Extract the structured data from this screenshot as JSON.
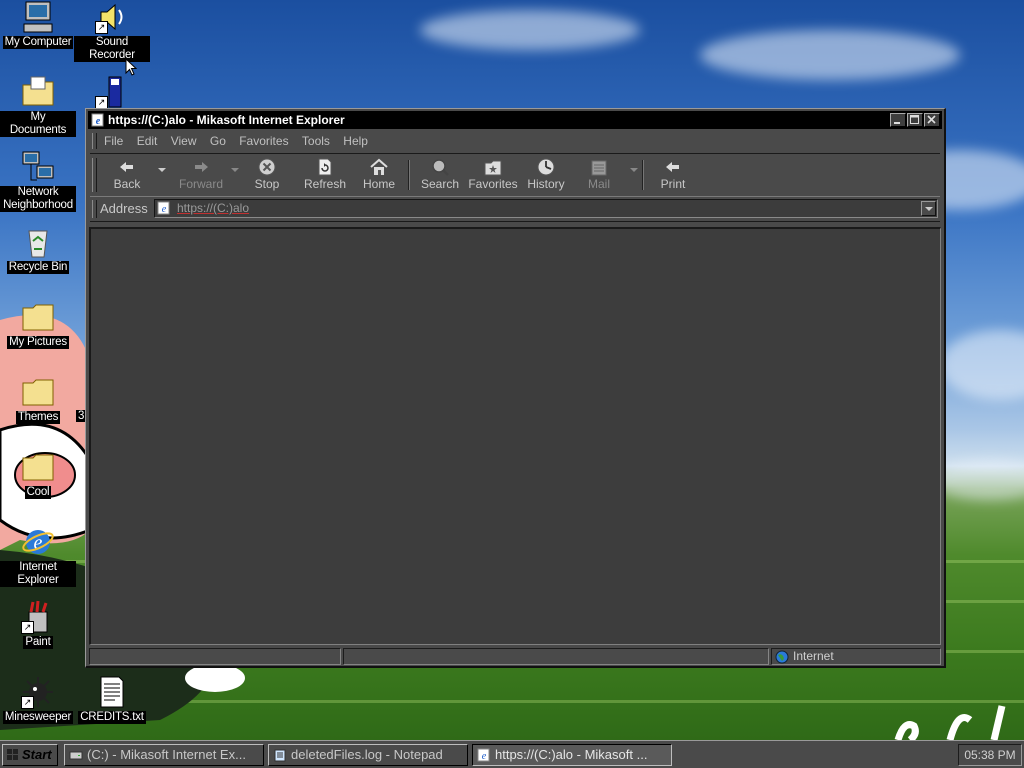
{
  "desktop": {
    "icons": [
      {
        "label": "My Computer",
        "icon": "computer-icon"
      },
      {
        "label": "Sound Recorder",
        "icon": "speaker-icon"
      },
      {
        "label": "My Documents",
        "icon": "folder-icon"
      },
      {
        "label": "Network Neighborhood",
        "icon": "network-icon"
      },
      {
        "label": "Recycle Bin",
        "icon": "recycle-bin-icon"
      },
      {
        "label": "My Pictures",
        "icon": "folder-icon"
      },
      {
        "label": "Themes",
        "icon": "folder-icon"
      },
      {
        "label": "Cool",
        "icon": "folder-icon"
      },
      {
        "label": "Internet Explorer",
        "icon": "ie-icon"
      },
      {
        "label": "Paint",
        "icon": "paint-icon"
      },
      {
        "label": "Minesweeper",
        "icon": "minesweeper-icon"
      },
      {
        "label": "CREDITS.txt",
        "icon": "text-file-icon"
      }
    ],
    "partial_label": "3"
  },
  "window": {
    "title": "https://(C:)alo - Mikasoft Internet Explorer",
    "menu": [
      "File",
      "Edit",
      "View",
      "Go",
      "Favorites",
      "Tools",
      "Help"
    ],
    "toolbar": {
      "back": "Back",
      "forward": "Forward",
      "stop": "Stop",
      "refresh": "Refresh",
      "home": "Home",
      "search": "Search",
      "favorites": "Favorites",
      "history": "History",
      "mail": "Mail",
      "print": "Print"
    },
    "address_label": "Address",
    "address_value": "https://(C:)alo",
    "status_zone": "Internet"
  },
  "taskbar": {
    "start": "Start",
    "tasks": [
      "(C:) - Mikasoft Internet Ex...",
      "deletedFiles.log - Notepad",
      "https://(C:)alo - Mikasoft ..."
    ],
    "clock": "05:38 PM"
  },
  "colors": {
    "window_bg": "#4a4a4a",
    "titlebar": "#000000",
    "content_bg": "#3d3d3d",
    "desktop_sky": "#3a74c4",
    "desktop_grass": "#3c7a1e"
  }
}
